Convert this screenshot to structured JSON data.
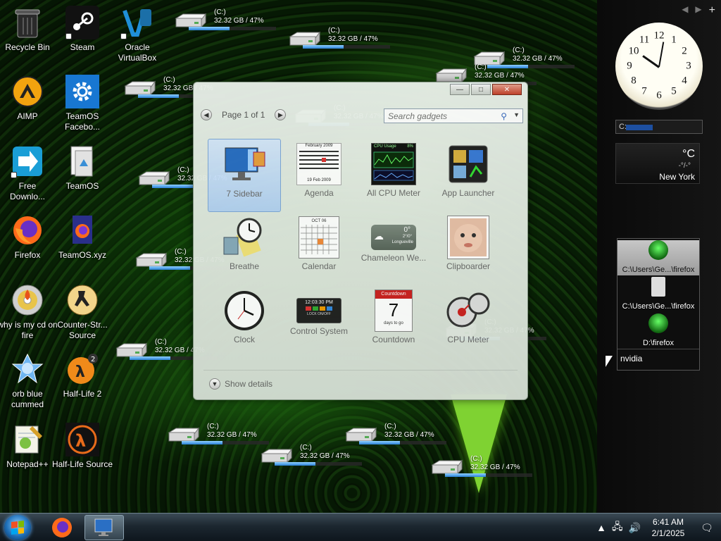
{
  "desktop": {
    "icons": [
      {
        "label": "Recycle Bin",
        "icon": "recycle-bin-icon"
      },
      {
        "label": "Steam",
        "icon": "steam-icon"
      },
      {
        "label": "Oracle VirtualBox",
        "icon": "virtualbox-icon"
      },
      {
        "label": "AIMP",
        "icon": "aimp-icon"
      },
      {
        "label": "TeamOS Facebo...",
        "icon": "settings-gear-icon"
      },
      {
        "label": "Free Downlo...",
        "icon": "download-arrow-icon"
      },
      {
        "label": "TeamOS",
        "icon": "document-icon"
      },
      {
        "label": "Firefox",
        "icon": "firefox-icon"
      },
      {
        "label": "TeamOS.xyz",
        "icon": "firefox-doc-icon"
      },
      {
        "label": "why is my cd on fire",
        "icon": "burning-cd-icon"
      },
      {
        "label": "Counter-Str... Source",
        "icon": "counter-strike-icon"
      },
      {
        "label": "orb blue cummed",
        "icon": "blue-orb-icon"
      },
      {
        "label": "Half-Life 2",
        "icon": "half-life-2-icon"
      },
      {
        "label": "Notepad++",
        "icon": "notepad-plus-plus-icon"
      },
      {
        "label": "Half-Life Source",
        "icon": "half-life-source-icon"
      }
    ]
  },
  "drive_meter": {
    "drive": "(C:)",
    "info": "32.32 GB / 47%",
    "used_fraction": 0.47
  },
  "gadget_gallery": {
    "page_label": "Page 1 of 1",
    "search_placeholder": "Search gadgets",
    "show_details": "Show details",
    "gadgets": [
      {
        "name": "7 Sidebar",
        "selected": true
      },
      {
        "name": "Agenda"
      },
      {
        "name": "All CPU Meter"
      },
      {
        "name": "App Launcher"
      },
      {
        "name": "Breathe"
      },
      {
        "name": "Calendar"
      },
      {
        "name": "Chameleon We..."
      },
      {
        "name": "Clipboarder"
      },
      {
        "name": "Clock"
      },
      {
        "name": "Control System"
      },
      {
        "name": "Countdown"
      },
      {
        "name": "CPU Meter"
      }
    ],
    "agenda_thumb": {
      "title": "February 2009",
      "footer": "19 Feb 2009"
    },
    "cpu_thumb": {
      "title": "CPU Usage",
      "value": "8%"
    },
    "calendar_thumb": {
      "month": "OCT 06"
    },
    "weather_thumb": {
      "temp": "0°",
      "range": "2°/0°",
      "place": "Longueville"
    },
    "control_thumb": {
      "time": "12:03:30 PM",
      "lock": "LOCK ON/OFF"
    },
    "countdown_thumb": {
      "title": "Countdown",
      "num": "7",
      "sub": "days to go"
    }
  },
  "sidebar": {
    "search_prefix": "C:",
    "weather": {
      "temp": "°C",
      "range": "-°/-°",
      "city": "New York"
    },
    "launcher": [
      {
        "path": "C:\\Users\\Ge...\\firefox"
      },
      {
        "path": "C:\\Users\\Ge...\\firefox"
      },
      {
        "path": "D:\\firefox"
      }
    ],
    "launcher_search": "nvidia"
  },
  "taskbar": {
    "time": "6:41 AM",
    "date": "2/1/2025"
  },
  "colors": {
    "accent_green": "#7fd232",
    "meter_blue": "#2a7fd6",
    "selection_blue": "#b4d2f2"
  }
}
